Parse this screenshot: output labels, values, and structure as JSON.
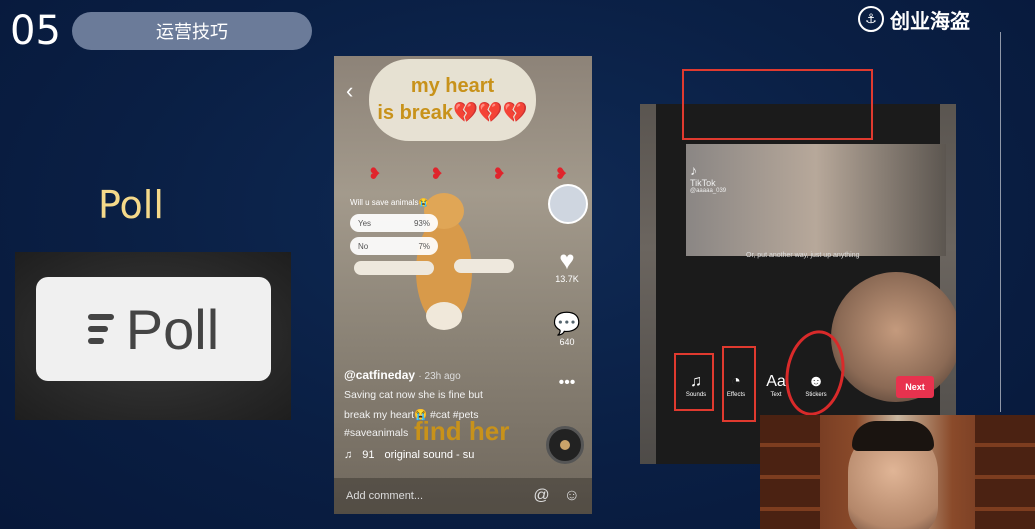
{
  "header": {
    "slide_number": "05",
    "section_title": "运营技巧",
    "brand_name": "创业海盗",
    "brand_icon": "anchor-icon"
  },
  "left": {
    "title": "Poll",
    "poll_button_label": "Poll"
  },
  "phone1": {
    "bubble_line1": "my heart",
    "bubble_line2": "is break💔💔💔",
    "poll_question": "Will u save animals😭",
    "poll_options": [
      {
        "label": "Yes",
        "percent": "93%"
      },
      {
        "label": "No",
        "percent": "7%"
      }
    ],
    "likes": "13.7K",
    "comments": "640",
    "handle": "@catfineday",
    "time_ago": "· 23h ago",
    "caption_line1": "Saving cat now she is fine but",
    "caption_line2": "break my heart😭 #cat #pets",
    "caption_line3": "#saveanimals",
    "find_her": "find her",
    "sound_count": "91",
    "sound_name": "original sound - su",
    "comment_placeholder": "Add comment..."
  },
  "phone2": {
    "app_name": "TikTok",
    "username": "@aaaaa_039",
    "subtitle": "Or, put another way, just up anything",
    "tools": [
      {
        "label": "Sounds",
        "icon": "music-note-icon"
      },
      {
        "label": "Effects",
        "icon": "effects-icon"
      },
      {
        "label": "Text",
        "icon": "text-icon"
      },
      {
        "label": "Stickers",
        "icon": "sticker-icon"
      }
    ],
    "next_label": "Next",
    "text_icon_glyph": "Aa"
  },
  "colors": {
    "accent_red": "#e03a2f",
    "poll_title": "#f5d98a",
    "tiktok_next": "#e8324e"
  }
}
